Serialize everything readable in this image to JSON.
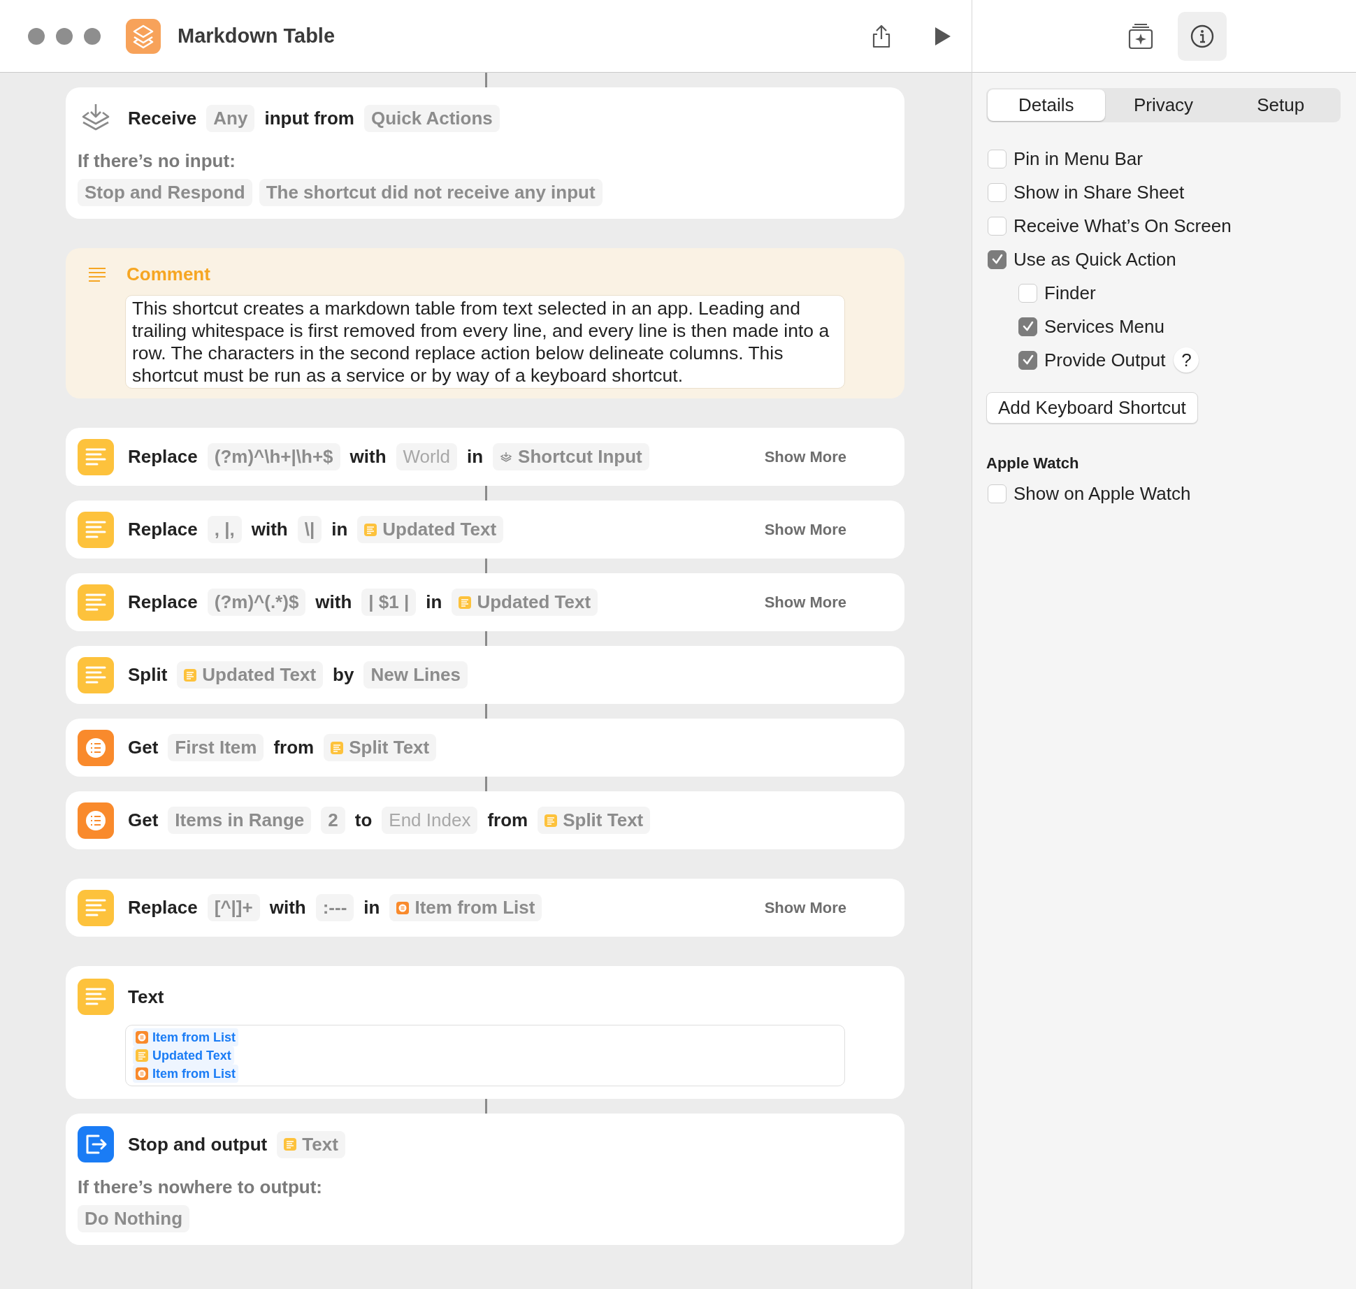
{
  "window": {
    "title": "Markdown Table"
  },
  "inspector_buttons": [
    {
      "kind": "gallery",
      "selected": false
    },
    {
      "kind": "info",
      "selected": true
    }
  ],
  "actions": [
    {
      "kind": "receive",
      "connected": true,
      "tokens": [
        {
          "kind": "word",
          "text": "Receive"
        },
        {
          "kind": "param",
          "text": "Any"
        },
        {
          "kind": "word",
          "text": "input from"
        },
        {
          "kind": "param",
          "text": "Quick Actions"
        }
      ],
      "fallback_label": "If there’s no input:",
      "fallback": [
        "Stop and Respond",
        "The shortcut did not receive any input"
      ]
    },
    {
      "kind": "comment",
      "connected": false,
      "title": "Comment",
      "body": "This shortcut creates a markdown table from text selected in an app. Leading and trailing whitespace is first removed from every line, and every line is then made into a row. The characters in the second replace action below delineate columns. This shortcut must be run as a service or by way of a keyboard shortcut."
    },
    {
      "kind": "text",
      "connected": false,
      "tokens": [
        {
          "kind": "word",
          "text": "Replace"
        },
        {
          "kind": "param",
          "text": "(?m)^\\h+|\\h+$"
        },
        {
          "kind": "word",
          "text": "with"
        },
        {
          "kind": "hint",
          "text": "World"
        },
        {
          "kind": "word",
          "text": "in"
        },
        {
          "kind": "var_input",
          "text": "Shortcut Input"
        }
      ],
      "show_more": "Show More"
    },
    {
      "kind": "text",
      "connected": true,
      "tokens": [
        {
          "kind": "word",
          "text": "Replace"
        },
        {
          "kind": "param",
          "text": ", |,"
        },
        {
          "kind": "word",
          "text": "with"
        },
        {
          "kind": "param",
          "text": "\\|"
        },
        {
          "kind": "word",
          "text": "in"
        },
        {
          "kind": "var_text",
          "text": "Updated Text"
        }
      ],
      "show_more": "Show More"
    },
    {
      "kind": "text",
      "connected": true,
      "tokens": [
        {
          "kind": "word",
          "text": "Replace"
        },
        {
          "kind": "param",
          "text": "(?m)^(.*)$"
        },
        {
          "kind": "word",
          "text": "with"
        },
        {
          "kind": "param",
          "text": "| $1 |"
        },
        {
          "kind": "word",
          "text": "in"
        },
        {
          "kind": "var_text",
          "text": "Updated Text"
        }
      ],
      "show_more": "Show More"
    },
    {
      "kind": "text",
      "connected": true,
      "tokens": [
        {
          "kind": "word",
          "text": "Split"
        },
        {
          "kind": "var_text",
          "text": "Updated Text"
        },
        {
          "kind": "word",
          "text": "by"
        },
        {
          "kind": "param",
          "text": "New Lines"
        }
      ]
    },
    {
      "kind": "list",
      "connected": true,
      "tokens": [
        {
          "kind": "word",
          "text": "Get"
        },
        {
          "kind": "param",
          "text": "First Item"
        },
        {
          "kind": "word",
          "text": "from"
        },
        {
          "kind": "var_text",
          "text": "Split Text"
        }
      ]
    },
    {
      "kind": "list",
      "connected": true,
      "tokens": [
        {
          "kind": "word",
          "text": "Get"
        },
        {
          "kind": "param",
          "text": "Items in Range"
        },
        {
          "kind": "param",
          "text": "2"
        },
        {
          "kind": "word",
          "text": "to"
        },
        {
          "kind": "hint",
          "text": "End Index"
        },
        {
          "kind": "word",
          "text": "from"
        },
        {
          "kind": "var_text",
          "text": "Split Text"
        }
      ]
    },
    {
      "kind": "text",
      "connected": false,
      "tokens": [
        {
          "kind": "word",
          "text": "Replace"
        },
        {
          "kind": "param",
          "text": "[^|]+"
        },
        {
          "kind": "word",
          "text": "with"
        },
        {
          "kind": "param",
          "text": ":---"
        },
        {
          "kind": "word",
          "text": "in"
        },
        {
          "kind": "var_list",
          "text": "Item from List"
        }
      ],
      "show_more": "Show More"
    },
    {
      "kind": "text_block",
      "connected": false,
      "tokens": [
        {
          "kind": "word",
          "text": "Text"
        }
      ],
      "lines": [
        {
          "kind": "var_list",
          "text": "Item from List"
        },
        {
          "kind": "var_text",
          "text": "Updated Text"
        },
        {
          "kind": "var_list",
          "text": "Item from List"
        }
      ]
    },
    {
      "kind": "output",
      "connected": true,
      "tokens": [
        {
          "kind": "word",
          "text": "Stop and output"
        },
        {
          "kind": "var_text",
          "text": "Text"
        }
      ],
      "fallback_label": "If there’s nowhere to output:",
      "fallback": [
        "Do Nothing"
      ]
    }
  ],
  "sidebar": {
    "tabs": [
      {
        "label": "Details",
        "selected": true
      },
      {
        "label": "Privacy",
        "selected": false
      },
      {
        "label": "Setup",
        "selected": false
      }
    ],
    "options": [
      {
        "label": "Pin in Menu Bar",
        "checked": false
      },
      {
        "label": "Show in Share Sheet",
        "checked": false
      },
      {
        "label": "Receive What’s On Screen",
        "checked": false
      },
      {
        "label": "Use as Quick Action",
        "checked": true,
        "children": [
          {
            "label": "Finder",
            "checked": false
          },
          {
            "label": "Services Menu",
            "checked": true
          },
          {
            "label": "Provide Output",
            "checked": true,
            "help": "?"
          }
        ]
      }
    ],
    "button": "Add Keyboard Shortcut",
    "section": {
      "title": "Apple Watch",
      "options": [
        {
          "label": "Show on Apple Watch",
          "checked": false
        }
      ]
    }
  }
}
